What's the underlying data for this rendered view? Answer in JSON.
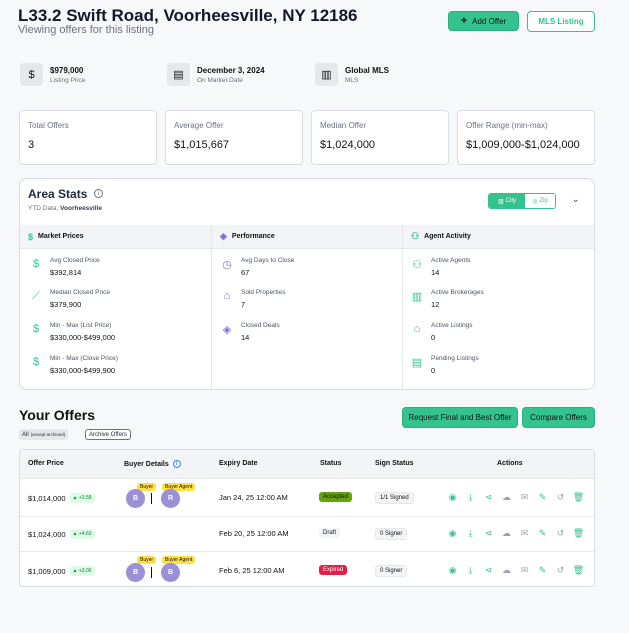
{
  "header": {
    "title": "L33.2 Swift Road, Voorheesville, NY 12186",
    "subtitle": "Viewing offers for this listing",
    "add_offer": "Add Offer",
    "mls_listing": "MLS Listing"
  },
  "meta": {
    "price": "$979,000",
    "price_label": "Listing Price",
    "date": "December 3, 2024",
    "date_label": "On Market Date",
    "mls": "Global MLS",
    "mls_label": "MLS"
  },
  "stats": [
    {
      "label": "Total Offers",
      "value": "3"
    },
    {
      "label": "Average Offer",
      "value": "$1,015,667"
    },
    {
      "label": "Median Offer",
      "value": "$1,024,000"
    },
    {
      "label": "Offer Range (min-max)",
      "value": "$1,009,000-$1,024,000"
    }
  ],
  "area": {
    "title": "Area Stats",
    "ytd_prefix": "YTD Data,",
    "ytd_place": "Voorheesville",
    "city": "City",
    "zip": "Zip",
    "col1": "Market Prices",
    "col2": "Performance",
    "col3": "Agent Activity",
    "market": [
      {
        "l": "Avg Closed Price",
        "v": "$392,814"
      },
      {
        "l": "Median Closed Price",
        "v": "$379,900"
      },
      {
        "l": "Min - Max (List Price)",
        "v": "$330,000-$499,000"
      },
      {
        "l": "Min - Max (Close Price)",
        "v": "$330,000-$499,900"
      }
    ],
    "perf": [
      {
        "l": "Avg Days to Close",
        "v": "67"
      },
      {
        "l": "Sold Properties",
        "v": "7"
      },
      {
        "l": "Closed Deals",
        "v": "14"
      }
    ],
    "agent": [
      {
        "l": "Active Agents",
        "v": "14"
      },
      {
        "l": "Active Brokerages",
        "v": "12"
      },
      {
        "l": "Active Listings",
        "v": "0"
      },
      {
        "l": "Pending Listings",
        "v": "0"
      }
    ]
  },
  "offers": {
    "title": "Your Offers",
    "filter_all": "All",
    "filter_all_note": "(except archived)",
    "filter_archive": "Archive Offers",
    "request_btn": "Request Final and Best Offer",
    "compare_btn": "Compare Offers",
    "cols": {
      "price": "Offer Price",
      "buyer": "Buyer Details",
      "expiry": "Expiry Date",
      "status": "Status",
      "sign": "Sign Status",
      "actions": "Actions"
    },
    "rows": [
      {
        "price": "$1,014,000",
        "diff": "+3.58",
        "b1": "B",
        "b2": "R",
        "t1": "Buyer",
        "t2": "Buyer Agent",
        "expiry": "Jan 24, 25 12:00 AM",
        "status": "Accepted",
        "sign": "1/1 Signed"
      },
      {
        "price": "$1,024,000",
        "diff": "+4.60",
        "expiry": "Feb 20, 25 12:00 AM",
        "status": "Draft",
        "sign": "0 Signer"
      },
      {
        "price": "$1,009,000",
        "diff": "+3.06",
        "b1": "B",
        "b2": "B",
        "t1": "Buyer",
        "t2": "Buyer Agent",
        "expiry": "Feb 6, 25 12:00 AM",
        "status": "Expired",
        "sign": "0 Signer"
      }
    ]
  },
  "colors": {
    "accent": "#34c38f",
    "accepted": "#65a30d",
    "expired": "#e11d48"
  }
}
